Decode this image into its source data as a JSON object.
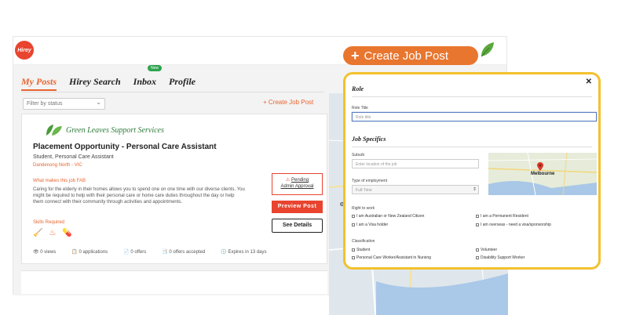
{
  "app": {
    "logo_text": "Hirey"
  },
  "nav": {
    "tabs": [
      "My Posts",
      "Hirey Search",
      "Inbox",
      "Profile"
    ],
    "new_badge": "New"
  },
  "filter": {
    "placeholder": "Filter by status"
  },
  "create_small": "+ Create Job Post",
  "card": {
    "brand": "Green Leaves Support Services",
    "title": "Placement Opportunity - Personal Care Assistant",
    "subtitle": "Student, Personal Care Assistant",
    "location": "Dandenong North - VIC",
    "fab_label": "What makes this job FAB",
    "description": "Caring for the elderly in their homes allows you to spend one on one time with our diverse clients. You might be required to help with their personal care or home care duties throughout the day or help them connect with their community through activities and appointments.",
    "skills_label": "Skills Required",
    "pending_line1": "Pending",
    "pending_line2": "Admin Approval",
    "preview_label": "Preview Post",
    "details_label": "See Details",
    "stats": [
      "0 views",
      "0 applications",
      "0 offers",
      "0 offers accepted",
      "Expires in 13 days"
    ]
  },
  "bgmap": {
    "city": "elbo"
  },
  "create_pill": {
    "label": "Create Job Post"
  },
  "modal": {
    "close": "✕",
    "role_heading": "Role",
    "role_title_label": "Role Title",
    "role_title_placeholder": "Role title",
    "specifics_heading": "Job Specifics",
    "suburb_label": "Suburb",
    "suburb_placeholder": "Enter location of the job",
    "employment_label": "Type of employment",
    "employment_value": "Full-Time",
    "right_to_work_label": "Right to work",
    "rtw_options": [
      "I am Australian or New Zealand Citizen",
      "I am a Permanent Resident",
      "I am a Visa holder",
      "I am overseas - need a visa/sponsorship"
    ],
    "classification_label": "Classification",
    "class_options": [
      "Student",
      "Volunteer",
      "Personal Care Worker/Assistant in Nursing",
      "Disability Support Worker"
    ],
    "map_city": "Melbourne"
  },
  "colors": {
    "accent": "#e8642f",
    "pill": "#e8762f",
    "modal_border": "#f2c12e",
    "brand_green": "#2c7a38"
  }
}
